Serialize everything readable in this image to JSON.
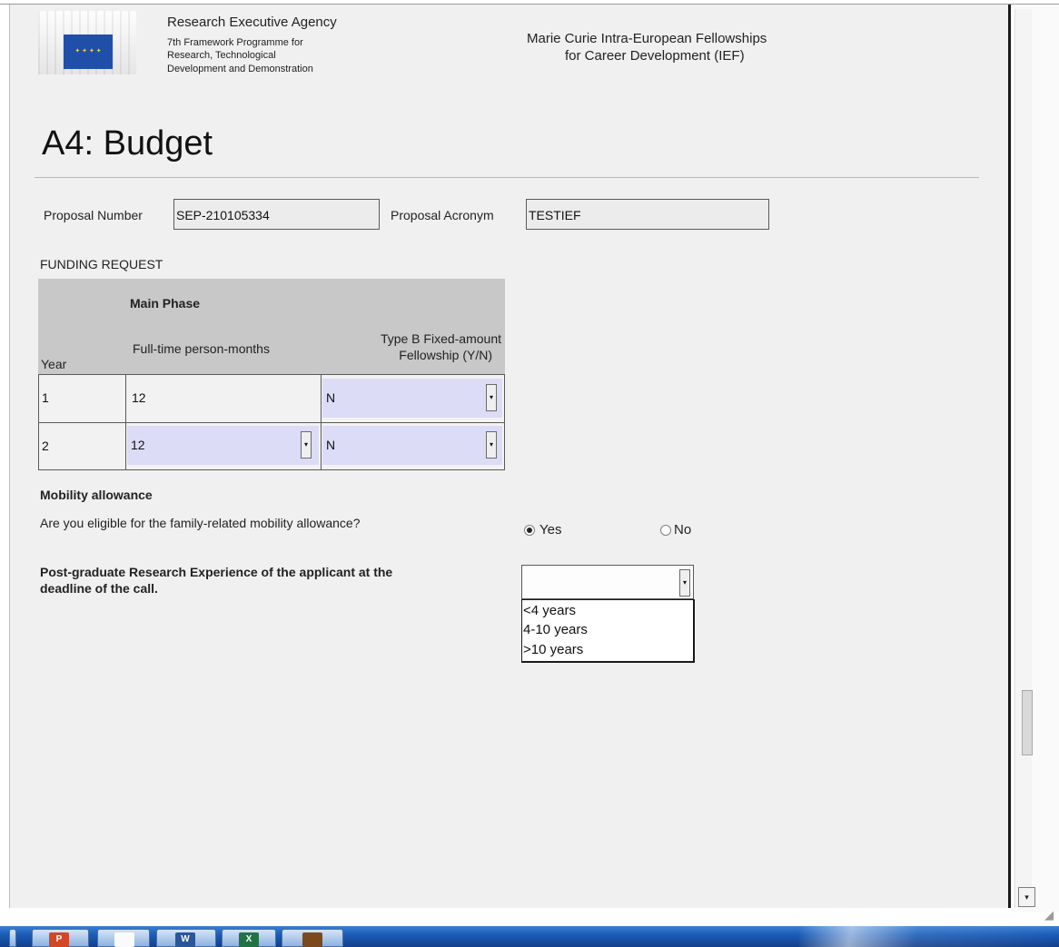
{
  "header": {
    "agency_name": "Research Executive Agency",
    "programme_lines": [
      "7th Framework Programme for",
      "Research, Technological",
      "Development and Demonstration"
    ],
    "fellowship_lines": [
      "Marie Curie Intra-European Fellowships",
      "for Career Development (IEF)"
    ],
    "flag_stars": "✦ ✦ ✦ ✦"
  },
  "page_title": "A4: Budget",
  "proposal": {
    "number_label": "Proposal Number",
    "number_value": "SEP-210105334",
    "acronym_label": "Proposal Acronym",
    "acronym_value": "TESTIEF"
  },
  "funding": {
    "heading": "FUNDING REQUEST",
    "main_phase": "Main Phase",
    "col_year": "Year",
    "col_months": "Full-time person-months",
    "col_typeb_line1": "Type B Fixed-amount",
    "col_typeb_line2": "Fellowship (Y/N)",
    "rows": [
      {
        "year": "1",
        "months": "12",
        "typeb": "N"
      },
      {
        "year": "2",
        "months": "12",
        "typeb": "N"
      }
    ]
  },
  "mobility": {
    "heading": "Mobility allowance",
    "question": "Are you eligible for the family-related mobility allowance?",
    "options": [
      "Yes",
      "No"
    ],
    "selected": "Yes"
  },
  "experience": {
    "question_lines": [
      "Post-graduate Research Experience of the applicant at the",
      "deadline of the call."
    ],
    "selected_value": "",
    "options": [
      "<4 years",
      "4-10 years",
      ">10 years"
    ]
  },
  "icons": {
    "dropdown_arrow": "▾",
    "scroll_down_arrow": "▾",
    "resize_grip": "◢"
  },
  "taskbar": {
    "apps": [
      "ppt",
      "pdf",
      "word",
      "excel",
      "folder"
    ],
    "icon_glyphs": [
      "P",
      "",
      "W",
      "X",
      ""
    ]
  },
  "colors": {
    "page_bg": "#f0f0f0",
    "table_header": "#c8c8c8",
    "select_highlight": "#dcdcf7",
    "taskbar": "#1c5db8",
    "flag": "#1f4fa8"
  }
}
